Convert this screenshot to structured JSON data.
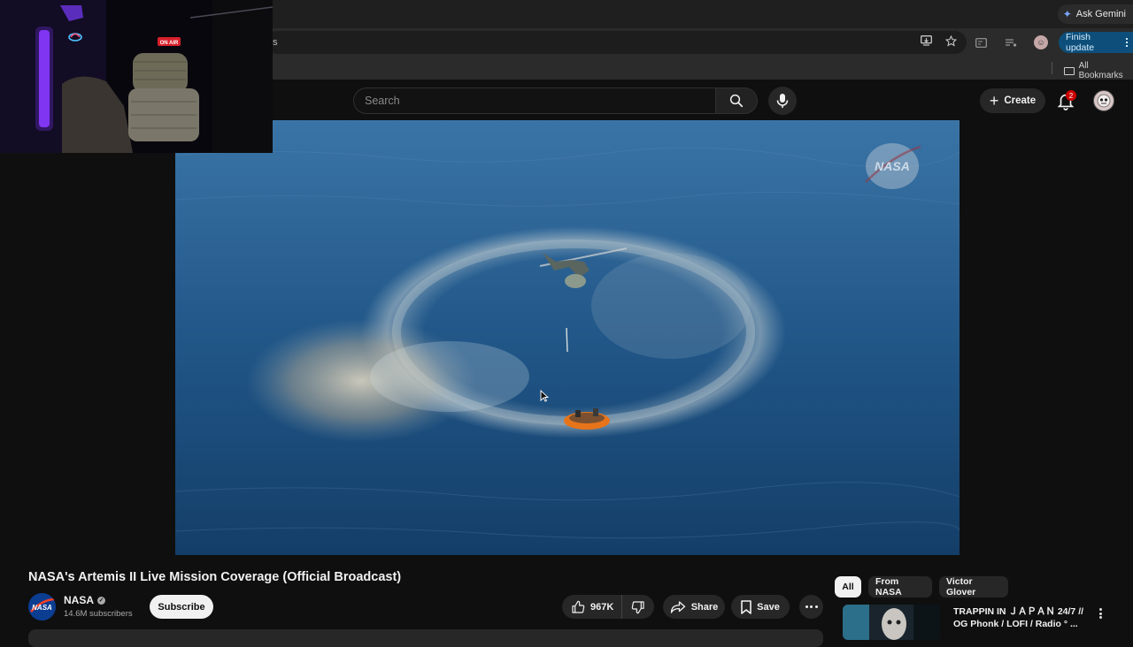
{
  "browser": {
    "ask_gemini_label": "Ask Gemini",
    "omnibox_partial": "s",
    "finish_update_label": "Finish update",
    "bookmarks_label": "All Bookmarks"
  },
  "header": {
    "search_placeholder": "Search",
    "create_label": "Create",
    "notification_count": "2"
  },
  "webcam": {
    "on_air_sign": "ON AIR"
  },
  "video": {
    "watermark": "NASA",
    "title": "NASA's Artemis II Live Mission Coverage (Official Broadcast)"
  },
  "channel": {
    "name": "NASA",
    "avatar_text": "NASA",
    "subscribers": "14.6M subscribers",
    "subscribe_label": "Subscribe"
  },
  "actions": {
    "like_count": "967K",
    "share_label": "Share",
    "save_label": "Save"
  },
  "chips": [
    "All",
    "From NASA",
    "Victor Glover"
  ],
  "recommendation": {
    "title": "TRAPPIN IN ＪＡＰＡＮ 24/7 // OG Phonk / LOFI / Radio ° ...",
    "subtitle": ""
  },
  "colors": {
    "background": "#0f0f0f",
    "finish_update_bg": "#0d4f7a",
    "notification_badge": "#cc0000",
    "lifeboat": "#e8741a"
  }
}
